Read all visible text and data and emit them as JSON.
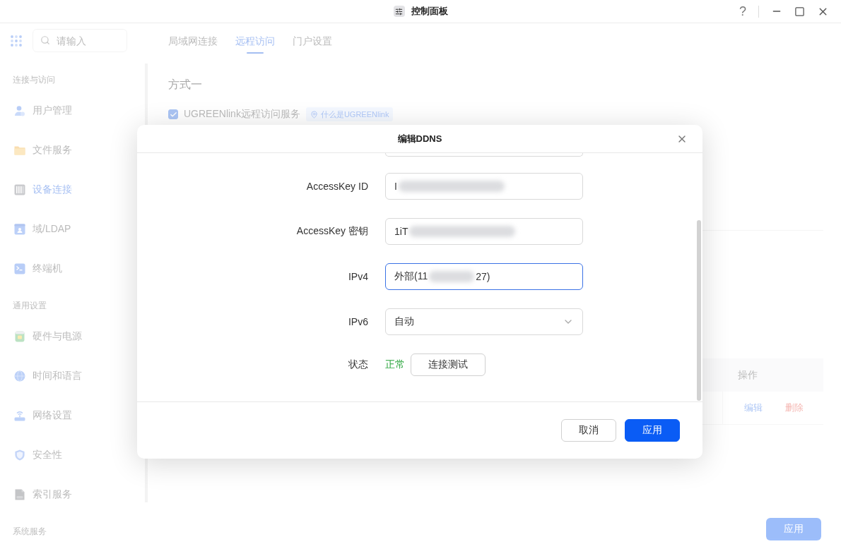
{
  "window": {
    "title": "控制面板",
    "help": "?"
  },
  "sidebar": {
    "search": {
      "placeholder": "请输入"
    },
    "sections": [
      {
        "title": "连接与访问",
        "items": [
          {
            "label": "用户管理",
            "selected": false
          },
          {
            "label": "文件服务",
            "selected": false
          },
          {
            "label": "设备连接",
            "selected": true
          },
          {
            "label": "域/LDAP",
            "selected": false
          },
          {
            "label": "终端机",
            "selected": false
          }
        ]
      },
      {
        "title": "通用设置",
        "items": [
          {
            "label": "硬件与电源",
            "selected": false
          },
          {
            "label": "时间和语言",
            "selected": false
          },
          {
            "label": "网络设置",
            "selected": false
          },
          {
            "label": "安全性",
            "selected": false
          },
          {
            "label": "索引服务",
            "selected": false
          }
        ]
      },
      {
        "title": "系统服务"
      }
    ]
  },
  "tabs": [
    {
      "label": "局域网连接",
      "selected": false
    },
    {
      "label": "远程访问",
      "selected": true
    },
    {
      "label": "门户设置",
      "selected": false
    }
  ],
  "method": {
    "title": "方式一",
    "service": {
      "label": "UGREENlink远程访问服务",
      "checked": true
    },
    "help_link": "什么是UGREENlink"
  },
  "table": {
    "columns": [
      "操作"
    ],
    "rows": [
      {
        "actions": [
          {
            "label": "编辑",
            "kind": "edit"
          },
          {
            "label": "删除",
            "kind": "delete"
          }
        ]
      }
    ]
  },
  "apply_button": "应用",
  "dialog": {
    "title": "编辑DDNS",
    "fields": [
      {
        "kind": "partial"
      },
      {
        "kind": "input",
        "label": "AccessKey ID",
        "value": "I",
        "redacted": true,
        "focused": false
      },
      {
        "kind": "input",
        "label": "AccessKey 密钥",
        "value": "1iT",
        "redacted": true,
        "focused": false
      },
      {
        "kind": "input",
        "label": "IPv4",
        "value": "外部(11",
        "value_end": "27)",
        "redacted": true,
        "focused": true
      },
      {
        "kind": "select",
        "label": "IPv6",
        "value": "自动"
      },
      {
        "kind": "status",
        "label": "状态",
        "status": "正常",
        "button": "连接测试"
      }
    ],
    "buttons": [
      {
        "label": "取消",
        "kind": "secondary"
      },
      {
        "label": "应用",
        "kind": "primary"
      }
    ]
  }
}
